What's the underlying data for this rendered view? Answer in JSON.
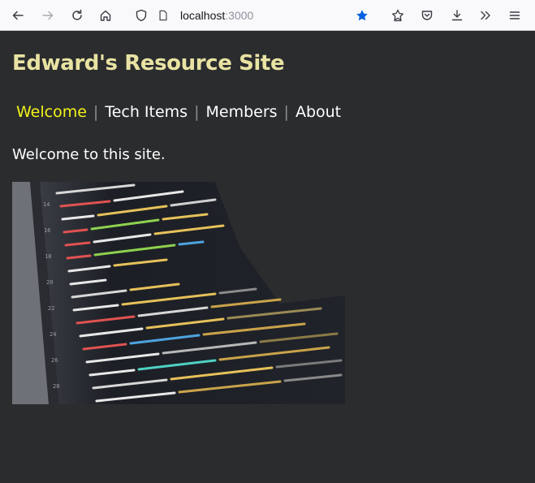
{
  "browser": {
    "url_host": "localhost",
    "url_port": ":3000",
    "icons": [
      "back-icon",
      "forward-icon",
      "reload-icon",
      "home-icon",
      "shield-icon",
      "page-icon",
      "bookmark-star-icon",
      "pocket-icon",
      "save-to-pocket-icon",
      "download-icon",
      "overflow-icon",
      "menu-icon"
    ],
    "star_color": "#0060df"
  },
  "site": {
    "title": "Edward's Resource Site",
    "nav": [
      {
        "label": "Welcome",
        "active": true
      },
      {
        "label": "Tech Items",
        "active": false
      },
      {
        "label": "Members",
        "active": false
      },
      {
        "label": "About",
        "active": false
      }
    ],
    "separator": "|",
    "welcome_text": "Welcome to this site.",
    "colors": {
      "title": "#e9e3a3",
      "active_nav": "#f2f21a",
      "background": "#2b2c2e"
    }
  }
}
